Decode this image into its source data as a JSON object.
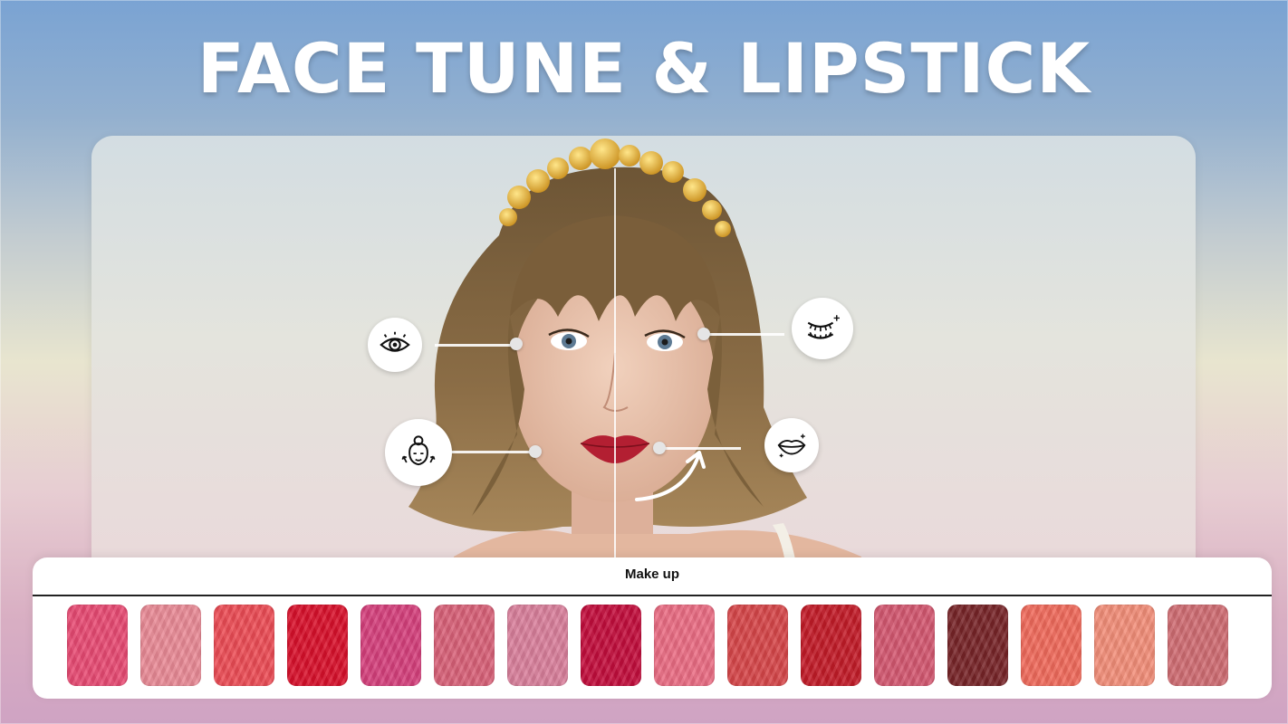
{
  "headline": "FACE TUNE & LIPSTICK",
  "features": {
    "eye": "eye-icon",
    "face": "face-lift-icon",
    "lashes": "eyelashes-icon",
    "lips": "lips-icon"
  },
  "makeup_panel": {
    "title": "Make up",
    "swatches": [
      "#e84a73",
      "#e98a96",
      "#ec4c55",
      "#d8102b",
      "#d5407c",
      "#d86178",
      "#d97f9b",
      "#c20d3c",
      "#ea6c83",
      "#d64649",
      "#c21b28",
      "#d35770",
      "#772428",
      "#f06a5b",
      "#f28e79",
      "#cf6c72"
    ]
  },
  "colors": {
    "accent": "#ffffff",
    "ink": "#111111"
  }
}
